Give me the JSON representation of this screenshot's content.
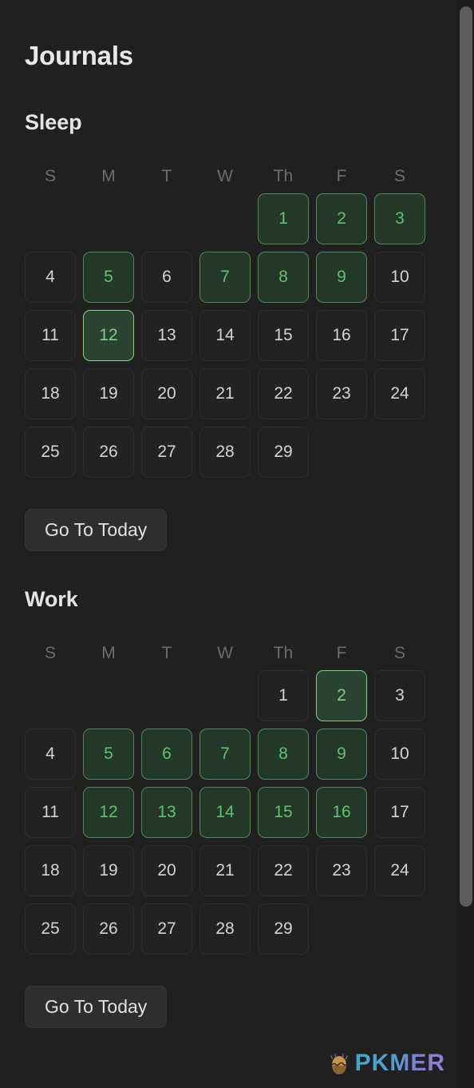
{
  "header": {
    "title": "Journals"
  },
  "scrollbar": {
    "name": "vertical-scrollbar"
  },
  "watermark": {
    "text": "PKMER",
    "icon": "egg-icon",
    "gradient_from": "#3fa9c9",
    "gradient_to": "#9b7fd4"
  },
  "colors": {
    "background": "#202020",
    "cell_background": "#222222",
    "cell_border": "#2e2e2e",
    "text": "#d4d4d4",
    "muted_text": "#6d6d6d",
    "marked_background": "#24382a",
    "marked_border": "#4e8a56",
    "marked_text": "#5cc46a",
    "today_border": "#7ed37f",
    "today_text": "#7ed37f",
    "button_background": "#2e2e2e"
  },
  "weekdays": [
    "S",
    "M",
    "T",
    "W",
    "Th",
    "F",
    "S"
  ],
  "sections": [
    {
      "id": "sleep",
      "title": "Sleep",
      "button_label": "Go To Today",
      "leading_blanks": 4,
      "days": [
        {
          "day": 1,
          "state": "marked"
        },
        {
          "day": 2,
          "state": "marked"
        },
        {
          "day": 3,
          "state": "marked"
        },
        {
          "day": 4,
          "state": "normal"
        },
        {
          "day": 5,
          "state": "marked"
        },
        {
          "day": 6,
          "state": "normal"
        },
        {
          "day": 7,
          "state": "marked"
        },
        {
          "day": 8,
          "state": "marked"
        },
        {
          "day": 9,
          "state": "marked"
        },
        {
          "day": 10,
          "state": "normal"
        },
        {
          "day": 11,
          "state": "normal"
        },
        {
          "day": 12,
          "state": "today"
        },
        {
          "day": 13,
          "state": "normal"
        },
        {
          "day": 14,
          "state": "normal"
        },
        {
          "day": 15,
          "state": "normal"
        },
        {
          "day": 16,
          "state": "normal"
        },
        {
          "day": 17,
          "state": "normal"
        },
        {
          "day": 18,
          "state": "normal"
        },
        {
          "day": 19,
          "state": "normal"
        },
        {
          "day": 20,
          "state": "normal"
        },
        {
          "day": 21,
          "state": "normal"
        },
        {
          "day": 22,
          "state": "normal"
        },
        {
          "day": 23,
          "state": "normal"
        },
        {
          "day": 24,
          "state": "normal"
        },
        {
          "day": 25,
          "state": "normal"
        },
        {
          "day": 26,
          "state": "normal"
        },
        {
          "day": 27,
          "state": "normal"
        },
        {
          "day": 28,
          "state": "normal"
        },
        {
          "day": 29,
          "state": "normal"
        }
      ]
    },
    {
      "id": "work",
      "title": "Work",
      "button_label": "Go To Today",
      "leading_blanks": 4,
      "days": [
        {
          "day": 1,
          "state": "normal"
        },
        {
          "day": 2,
          "state": "today"
        },
        {
          "day": 3,
          "state": "normal"
        },
        {
          "day": 4,
          "state": "normal"
        },
        {
          "day": 5,
          "state": "marked"
        },
        {
          "day": 6,
          "state": "marked"
        },
        {
          "day": 7,
          "state": "marked"
        },
        {
          "day": 8,
          "state": "marked"
        },
        {
          "day": 9,
          "state": "marked"
        },
        {
          "day": 10,
          "state": "normal"
        },
        {
          "day": 11,
          "state": "normal"
        },
        {
          "day": 12,
          "state": "marked"
        },
        {
          "day": 13,
          "state": "marked"
        },
        {
          "day": 14,
          "state": "marked"
        },
        {
          "day": 15,
          "state": "marked"
        },
        {
          "day": 16,
          "state": "marked"
        },
        {
          "day": 17,
          "state": "normal"
        },
        {
          "day": 18,
          "state": "normal"
        },
        {
          "day": 19,
          "state": "normal"
        },
        {
          "day": 20,
          "state": "normal"
        },
        {
          "day": 21,
          "state": "normal"
        },
        {
          "day": 22,
          "state": "normal"
        },
        {
          "day": 23,
          "state": "normal"
        },
        {
          "day": 24,
          "state": "normal"
        },
        {
          "day": 25,
          "state": "normal"
        },
        {
          "day": 26,
          "state": "normal"
        },
        {
          "day": 27,
          "state": "normal"
        },
        {
          "day": 28,
          "state": "normal"
        },
        {
          "day": 29,
          "state": "normal"
        }
      ]
    }
  ]
}
